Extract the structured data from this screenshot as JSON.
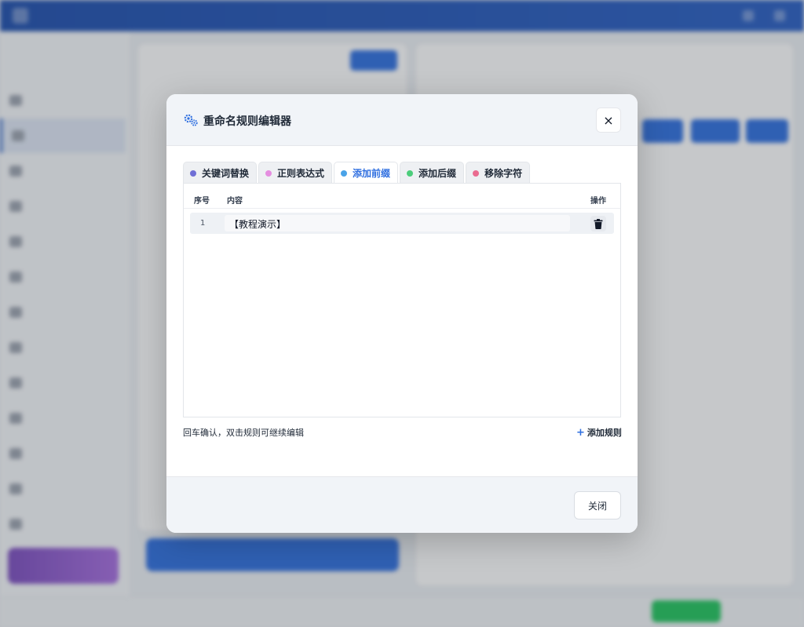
{
  "modal": {
    "title": "重命名规则编辑器",
    "close_symbol": "×",
    "tabs": [
      {
        "label": "关键词替换",
        "color": "#6f6fd6",
        "active": false
      },
      {
        "label": "正则表达式",
        "color": "#e58ee0",
        "active": false
      },
      {
        "label": "添加前缀",
        "color": "#4aa3e8",
        "active": true
      },
      {
        "label": "添加后缀",
        "color": "#4ccd7b",
        "active": false
      },
      {
        "label": "移除字符",
        "color": "#ea6b90",
        "active": false
      }
    ],
    "table": {
      "headers": {
        "index": "序号",
        "content": "内容",
        "action": "操作"
      },
      "rows": [
        {
          "index": "1",
          "content": "【教程演示】"
        }
      ]
    },
    "hint": "回车确认，双击规则可继续编辑",
    "add_rule_label": "添加规则",
    "footer_close_label": "关闭"
  },
  "colors": {
    "accent": "#2f6fe0",
    "header_bg": "#1f4fae"
  }
}
